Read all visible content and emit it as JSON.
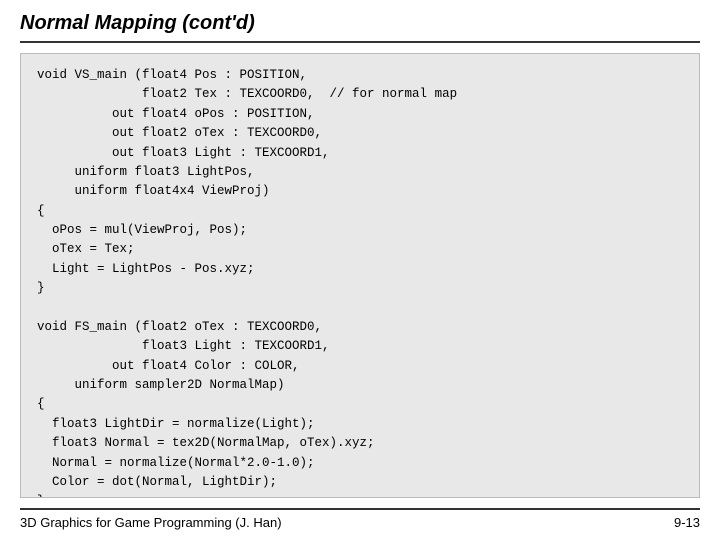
{
  "title": "Normal Mapping (cont'd)",
  "code": "void VS_main (float4 Pos : POSITION,\n              float2 Tex : TEXCOORD0,  // for normal map\n          out float4 oPos : POSITION,\n          out float2 oTex : TEXCOORD0,\n          out float3 Light : TEXCOORD1,\n     uniform float3 LightPos,\n     uniform float4x4 ViewProj)\n{\n  oPos = mul(ViewProj, Pos);\n  oTex = Tex;\n  Light = LightPos - Pos.xyz;\n}\n\nvoid FS_main (float2 oTex : TEXCOORD0,\n              float3 Light : TEXCOORD1,\n          out float4 Color : COLOR,\n     uniform sampler2D NormalMap)\n{\n  float3 LightDir = normalize(Light);\n  float3 Normal = tex2D(NormalMap, oTex).xyz;\n  Normal = normalize(Normal*2.0-1.0);\n  Color = dot(Normal, LightDir);\n}",
  "footer": {
    "left": "3D Graphics for Game Programming (J. Han)",
    "right": "9-13"
  }
}
